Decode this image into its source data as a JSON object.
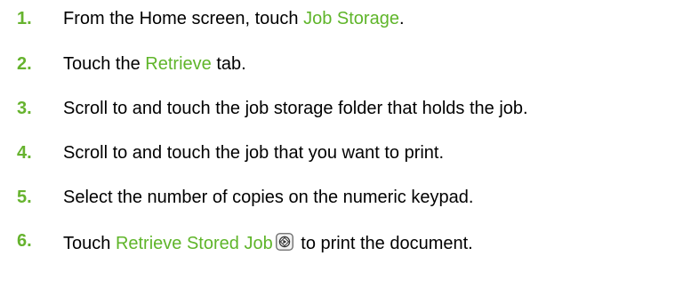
{
  "colors": {
    "step_number": "#66b32e",
    "ui_reference": "#5fb52a",
    "text": "#000000"
  },
  "steps": [
    {
      "number": "1.",
      "before": "From the Home screen, touch ",
      "ui_ref": "Job Storage",
      "after": "."
    },
    {
      "number": "2.",
      "before": "Touch the ",
      "ui_ref": "Retrieve",
      "after": " tab."
    },
    {
      "number": "3.",
      "text": "Scroll to and touch the job storage folder that holds the job."
    },
    {
      "number": "4.",
      "text": "Scroll to and touch the job that you want to print."
    },
    {
      "number": "5.",
      "text": "Select the number of copies on the numeric keypad."
    },
    {
      "number": "6.",
      "before": "Touch ",
      "ui_ref": "Retrieve Stored Job",
      "icon": "start-button-icon",
      "after": " to print the document."
    }
  ]
}
